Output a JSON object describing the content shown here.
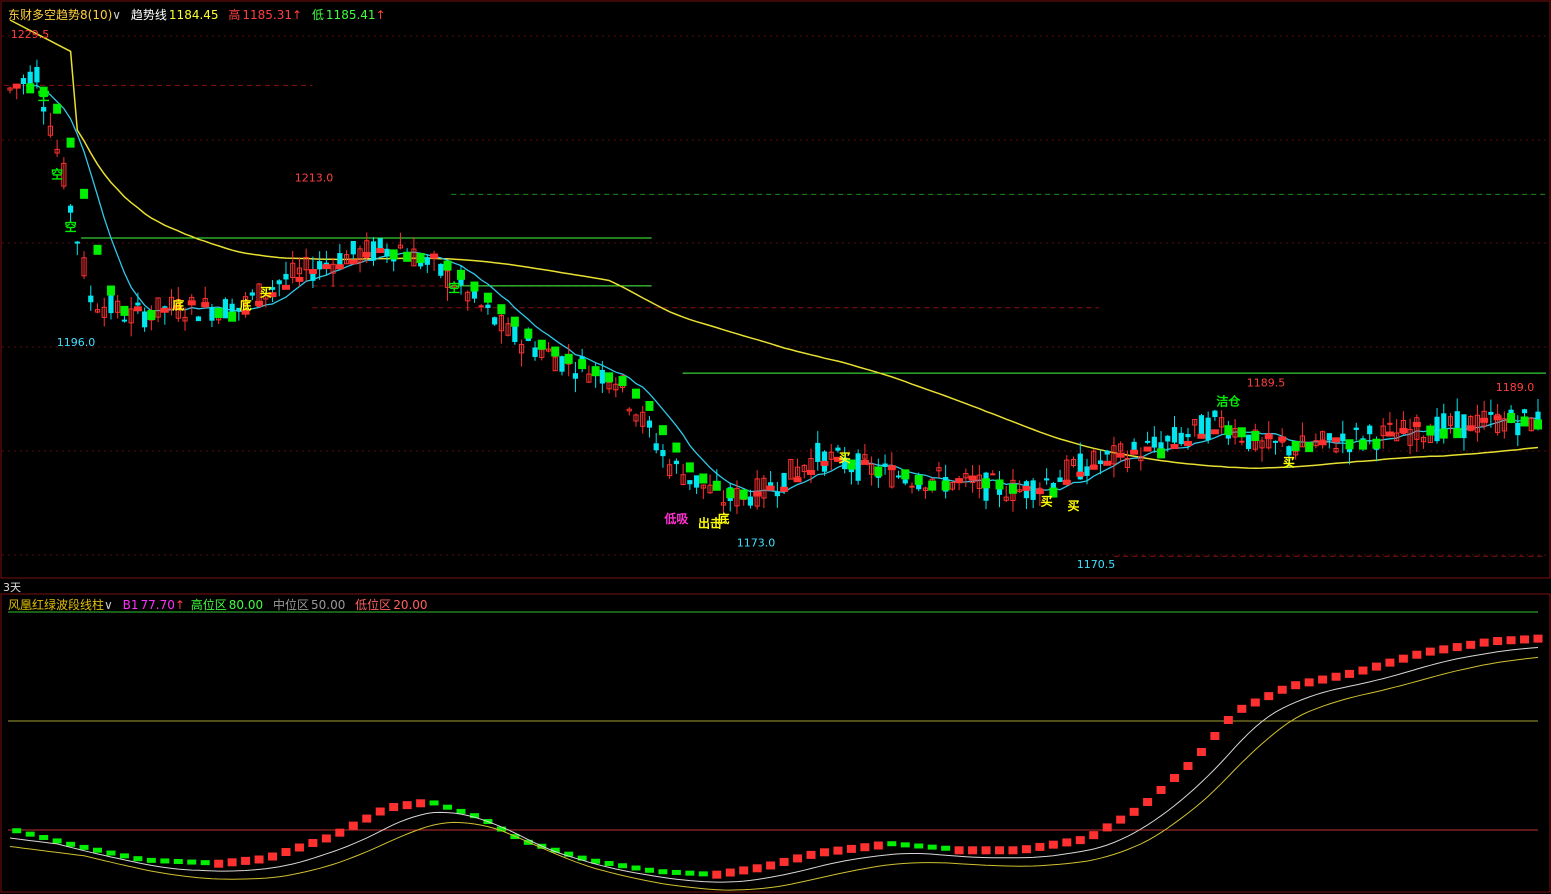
{
  "header_top": {
    "indicator_name": "东财多空趋势8(10)",
    "chevron": "∨",
    "line_label": "趋势线",
    "line_value": "1184.45",
    "high_label": "高",
    "high_value": "1185.31",
    "low_label": "低",
    "low_value": "1185.41",
    "up_arrow": "↑"
  },
  "header_bottom": {
    "indicator_name": "风凰红绿波段线柱",
    "chevron": "∨",
    "b1_label": "B1",
    "b1_value": "77.70",
    "high_zone_label": "高位区",
    "high_zone_value": "80.00",
    "mid_zone_label": "中位区",
    "mid_zone_value": "50.00",
    "low_zone_label": "低位区",
    "low_zone_value": "20.00",
    "up_arrow": "↑"
  },
  "period_label": "3天",
  "colors": {
    "up_red": "#ff3030",
    "down_cyan": "#00e5ee",
    "trend_green": "#00ee00",
    "ma_yellow": "#e8e030",
    "ma_cyan": "#30c8e8",
    "grid_red": "#8b1010",
    "grid_green": "#1a8a1a",
    "magenta": "#ff30d0",
    "yellow_bar": "#ffff00"
  },
  "chart_data": [
    {
      "type": "candlestick",
      "name": "price",
      "price_labels": [
        {
          "text": "1229.5",
          "price": 1229.5,
          "color": "#ff4040"
        },
        {
          "text": "1213.0",
          "price": 1213.0,
          "color": "#ff4040"
        },
        {
          "text": "1196.0",
          "price": 1196.0,
          "color": "#40e0ff"
        },
        {
          "text": "1173.0",
          "price": 1173.0,
          "color": "#40e0ff"
        },
        {
          "text": "1170.5",
          "price": 1170.5,
          "color": "#40e0ff"
        },
        {
          "text": "1189.5",
          "price": 1189.5,
          "color": "#ff4040"
        },
        {
          "text": "1189.0",
          "price": 1189.0,
          "color": "#ff4040"
        }
      ],
      "signals": [
        {
          "text": "空",
          "bar": 5,
          "price": 1223.5,
          "color": "#00ee00"
        },
        {
          "text": "空",
          "bar": 7,
          "price": 1214.5,
          "color": "#00ee00"
        },
        {
          "text": "空",
          "bar": 9,
          "price": 1208.5,
          "color": "#00ee00"
        },
        {
          "text": "底",
          "bar": 25,
          "price": 1199.5,
          "color": "#ffff00"
        },
        {
          "text": "底",
          "bar": 35,
          "price": 1199.5,
          "color": "#ffff00"
        },
        {
          "text": "买",
          "bar": 38,
          "price": 1201.0,
          "color": "#ffff00"
        },
        {
          "text": "空",
          "bar": 66,
          "price": 1201.5,
          "color": "#00ee00"
        },
        {
          "text": "低吸",
          "bar": 99,
          "price": 1175.0,
          "color": "#ff30d0"
        },
        {
          "text": "底",
          "bar": 106,
          "price": 1175.0,
          "color": "#ffff00"
        },
        {
          "text": "出击",
          "bar": 104,
          "price": 1174.5,
          "color": "#ffff00"
        },
        {
          "text": "买",
          "bar": 124,
          "price": 1182.0,
          "color": "#ffff00"
        },
        {
          "text": "买",
          "bar": 154,
          "price": 1177.0,
          "color": "#ffff00"
        },
        {
          "text": "买",
          "bar": 158,
          "price": 1176.5,
          "color": "#ffff00"
        },
        {
          "text": "洁仓",
          "bar": 181,
          "price": 1188.5,
          "color": "#00ee00"
        },
        {
          "text": "买",
          "bar": 190,
          "price": 1181.5,
          "color": "#ffff00"
        }
      ],
      "hlines": [
        {
          "price": 1224.5,
          "from": 0,
          "to": 0.2,
          "color": "#8b1010",
          "dash": true
        },
        {
          "price": 1212.0,
          "from": 0.29,
          "to": 1,
          "color": "#1a8a1a",
          "dash": true
        },
        {
          "price": 1201.5,
          "from": 0.2,
          "to": 0.42,
          "color": "#8b1010",
          "dash": true
        },
        {
          "price": 1207.0,
          "from": 0.05,
          "to": 0.42,
          "color": "#40ff40",
          "dash": false
        },
        {
          "price": 1201.5,
          "from": 0.29,
          "to": 0.42,
          "color": "#40ff40",
          "dash": false
        },
        {
          "price": 1199.0,
          "from": 0.2,
          "to": 0.71,
          "color": "#8b1010",
          "dash": true
        },
        {
          "price": 1191.5,
          "from": 0.44,
          "to": 1,
          "color": "#40ff40",
          "dash": false
        },
        {
          "price": 1170.5,
          "from": 0.72,
          "to": 1,
          "color": "#8b1010",
          "dash": true
        }
      ]
    },
    {
      "type": "bar-line",
      "name": "oscillator",
      "levels": [
        80.0,
        50.0,
        20.0
      ],
      "b1_last": 77.7
    }
  ]
}
